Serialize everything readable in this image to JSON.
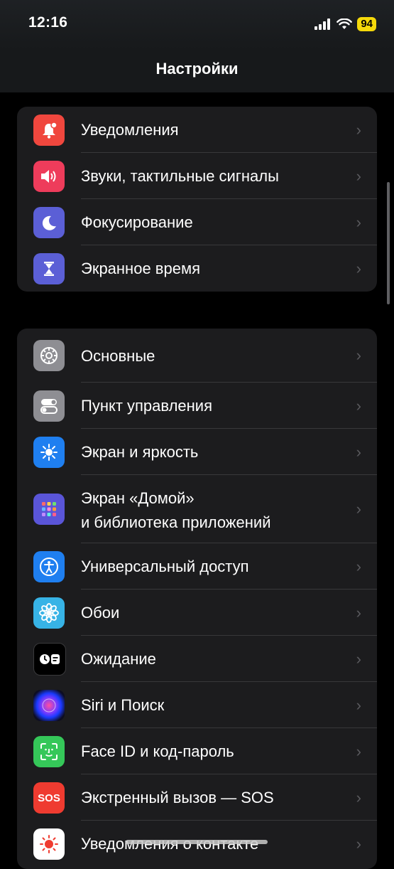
{
  "status": {
    "time": "12:16",
    "battery": "94"
  },
  "nav": {
    "title": "Настройки"
  },
  "group1": [
    {
      "label": "Уведомления",
      "icon": "bell-icon",
      "color": "#f0473e"
    },
    {
      "label": "Звуки, тактильные сигналы",
      "icon": "speaker-icon",
      "color": "#ee3c5b"
    },
    {
      "label": "Фокусирование",
      "icon": "moon-icon",
      "color": "#5b5fd6"
    },
    {
      "label": "Экранное время",
      "icon": "hourglass-icon",
      "color": "#5b5fd6"
    }
  ],
  "group2": [
    {
      "label": "Основные",
      "icon": "gear-icon",
      "color": "#8e8e93"
    },
    {
      "label": "Пункт управления",
      "icon": "toggles-icon",
      "color": "#8e8e93"
    },
    {
      "label": "Экран и яркость",
      "icon": "sun-icon",
      "color": "#1f7ff0"
    },
    {
      "label": "Экран «Домой»",
      "label2": "и библиотека приложений",
      "icon": "app-grid-icon",
      "color": "#5a55d8"
    },
    {
      "label": "Универсальный доступ",
      "icon": "accessibility-icon",
      "color": "#1f7ff0"
    },
    {
      "label": "Обои",
      "icon": "flower-icon",
      "color": "#37b3e6"
    },
    {
      "label": "Ожидание",
      "icon": "standby-icon",
      "color": "#000000"
    },
    {
      "label": "Siri и Поиск",
      "icon": "siri-icon",
      "color": "#1b1b3a"
    },
    {
      "label": "Face ID и код-пароль",
      "icon": "face-id-icon",
      "color": "#35c759"
    },
    {
      "label": "Экстренный вызов — SOS",
      "icon": "sos-icon",
      "color": "#ef3b30"
    },
    {
      "label": "Уведомления о контакте",
      "icon": "exposure-icon",
      "color": "#ffffff"
    }
  ]
}
